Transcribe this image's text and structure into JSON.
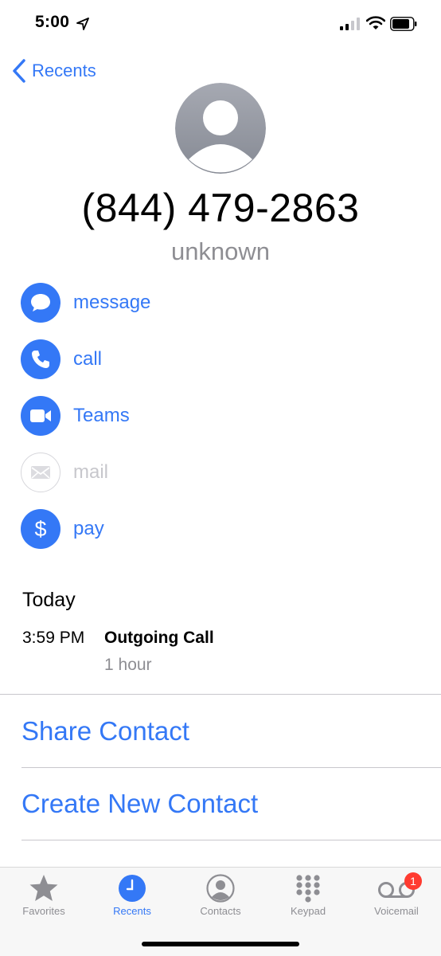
{
  "status_bar": {
    "time": "5:00"
  },
  "nav": {
    "back_label": "Recents"
  },
  "contact": {
    "phone_number": "(844) 479-2863",
    "number_label": "unknown"
  },
  "actions": [
    {
      "label": "message",
      "icon": "message-bubble-icon",
      "enabled": true
    },
    {
      "label": "call",
      "icon": "phone-icon",
      "enabled": true
    },
    {
      "label": "Teams",
      "icon": "video-icon",
      "enabled": true
    },
    {
      "label": "mail",
      "icon": "envelope-icon",
      "enabled": false
    },
    {
      "label": "pay",
      "icon": "dollar-icon",
      "enabled": true
    }
  ],
  "history": {
    "heading": "Today",
    "entries": [
      {
        "time": "3:59 PM",
        "type": "Outgoing Call",
        "duration": "1 hour"
      }
    ]
  },
  "links": {
    "share_contact": "Share Contact",
    "create_new_contact": "Create New Contact"
  },
  "tab_bar": {
    "active": "Recents",
    "tabs": [
      {
        "label": "Favorites",
        "icon": "star-icon"
      },
      {
        "label": "Recents",
        "icon": "clock-icon"
      },
      {
        "label": "Contacts",
        "icon": "person-circle-icon"
      },
      {
        "label": "Keypad",
        "icon": "keypad-icon"
      },
      {
        "label": "Voicemail",
        "icon": "voicemail-icon",
        "badge": "1"
      }
    ]
  },
  "colors": {
    "accent": "#3478f6",
    "secondary_text": "#8e8e93",
    "badge": "#ff3b30"
  }
}
